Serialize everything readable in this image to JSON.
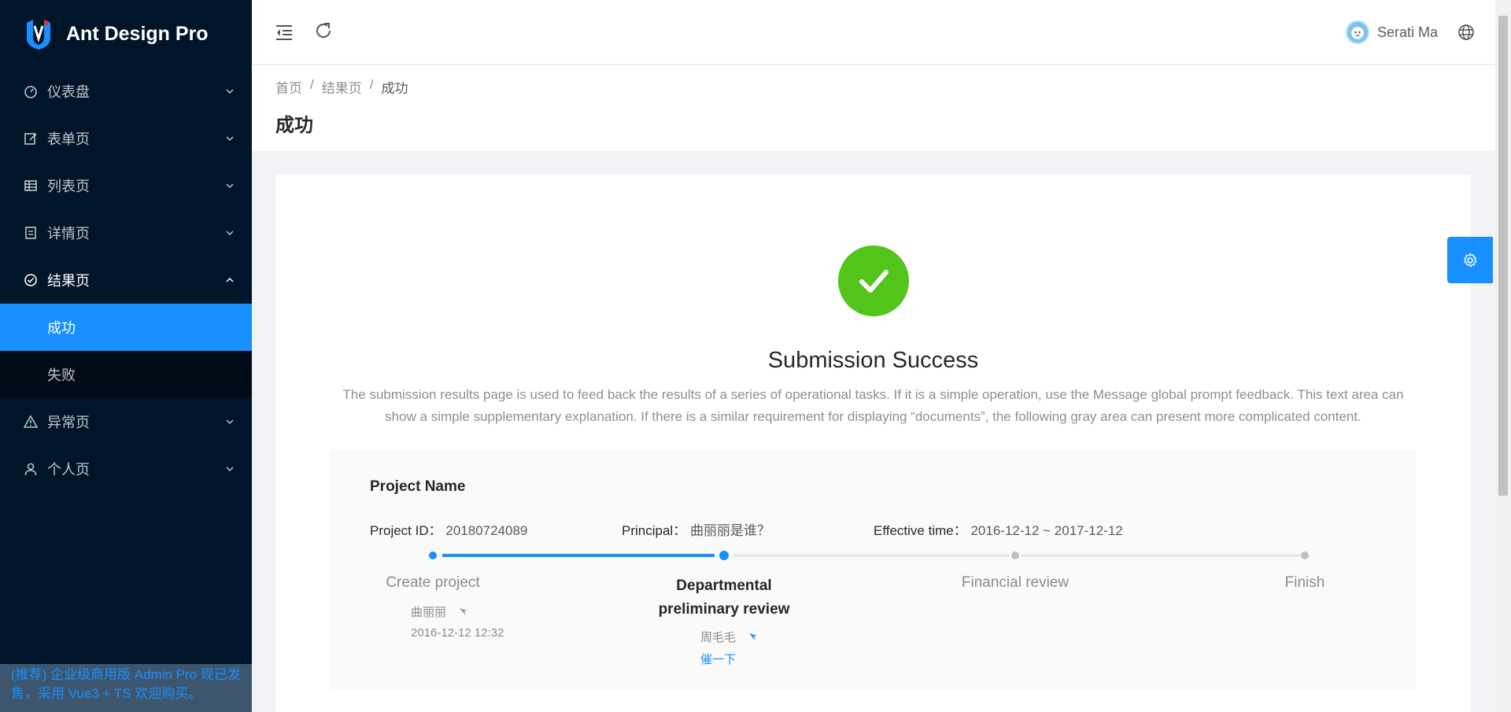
{
  "app": {
    "title": "Ant Design Pro"
  },
  "sidebar": {
    "items": [
      {
        "label": "仪表盘",
        "icon": "dashboard-icon"
      },
      {
        "label": "表单页",
        "icon": "form-icon"
      },
      {
        "label": "列表页",
        "icon": "table-icon"
      },
      {
        "label": "详情页",
        "icon": "profile-icon"
      },
      {
        "label": "结果页",
        "icon": "check-circle-icon"
      },
      {
        "label": "异常页",
        "icon": "warning-icon"
      },
      {
        "label": "个人页",
        "icon": "user-icon"
      }
    ],
    "result_sub": [
      {
        "label": "成功"
      },
      {
        "label": "失败"
      }
    ],
    "promo": "(推荐) 企业级商用版 Admin Pro 现已发售，采用 Vue3 + TS 欢迎购买。"
  },
  "header": {
    "user_name": "Serati Ma"
  },
  "breadcrumb": {
    "home": "首页",
    "parent": "结果页",
    "current": "成功",
    "sep": "/"
  },
  "page": {
    "title": "成功"
  },
  "result": {
    "title": "Submission Success",
    "description": "The submission results page is used to feed back the results of a series of operational tasks. If it is a simple operation, use the Message global prompt feedback. This text area can show a simple supplementary explanation. If there is a similar requirement for displaying “documents”, the following gray area can present more complicated content."
  },
  "project": {
    "name": "Project Name",
    "id_label": "Project ID：",
    "id_value": "20180724089",
    "principal_label": "Principal：",
    "principal_value": "曲丽丽是谁？",
    "time_label": "Effective time：",
    "time_value": "2016-12-12 ~ 2017-12-12"
  },
  "steps": [
    {
      "title": "Create project",
      "person": "曲丽丽",
      "time": "2016-12-12 12:32",
      "status": "finish"
    },
    {
      "title_line1": "Departmental",
      "title_line2": "preliminary review",
      "person": "周毛毛",
      "action": "催一下",
      "status": "process"
    },
    {
      "title": "Financial review",
      "status": "wait"
    },
    {
      "title": "Finish",
      "status": "wait"
    }
  ],
  "colors": {
    "primary": "#1890ff",
    "success": "#52c41a",
    "sider": "#001529"
  }
}
